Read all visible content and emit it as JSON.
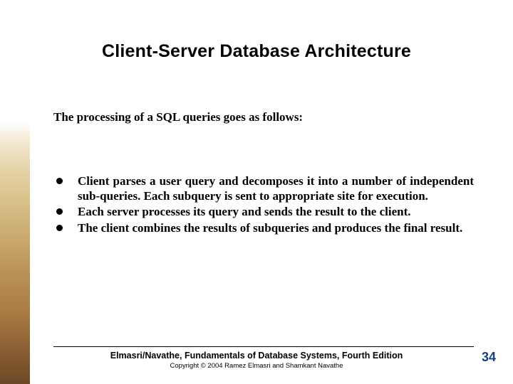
{
  "title": "Client-Server Database Architecture",
  "intro": "The processing of a SQL queries goes as follows:",
  "bullets": [
    "Client parses a user query and decomposes it into a number of independent sub-queries. Each subquery is sent to appropriate site for execution.",
    "Each server processes its query and sends the result to the client.",
    "The client combines the results of subqueries and produces the final result."
  ],
  "footer_main": "Elmasri/Navathe, Fundamentals of Database Systems, Fourth Edition",
  "footer_sub": "Copyright © 2004 Ramez Elmasri and Shamkant Navathe",
  "page_number": "34"
}
